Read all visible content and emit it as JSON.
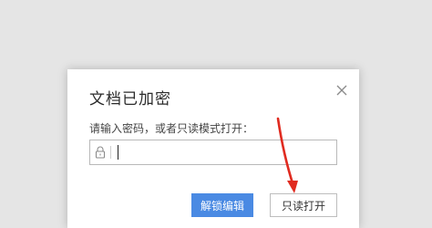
{
  "dialog": {
    "title": "文档已加密",
    "prompt": "请输入密码，或者只读模式打开：",
    "password_value": "",
    "unlock_label": "解锁编辑",
    "readonly_label": "只读打开"
  },
  "colors": {
    "primary_button": "#4a8ae3",
    "annotation_arrow": "#e02b20"
  },
  "icons": {
    "close": "close-icon",
    "lock": "lock-icon"
  }
}
